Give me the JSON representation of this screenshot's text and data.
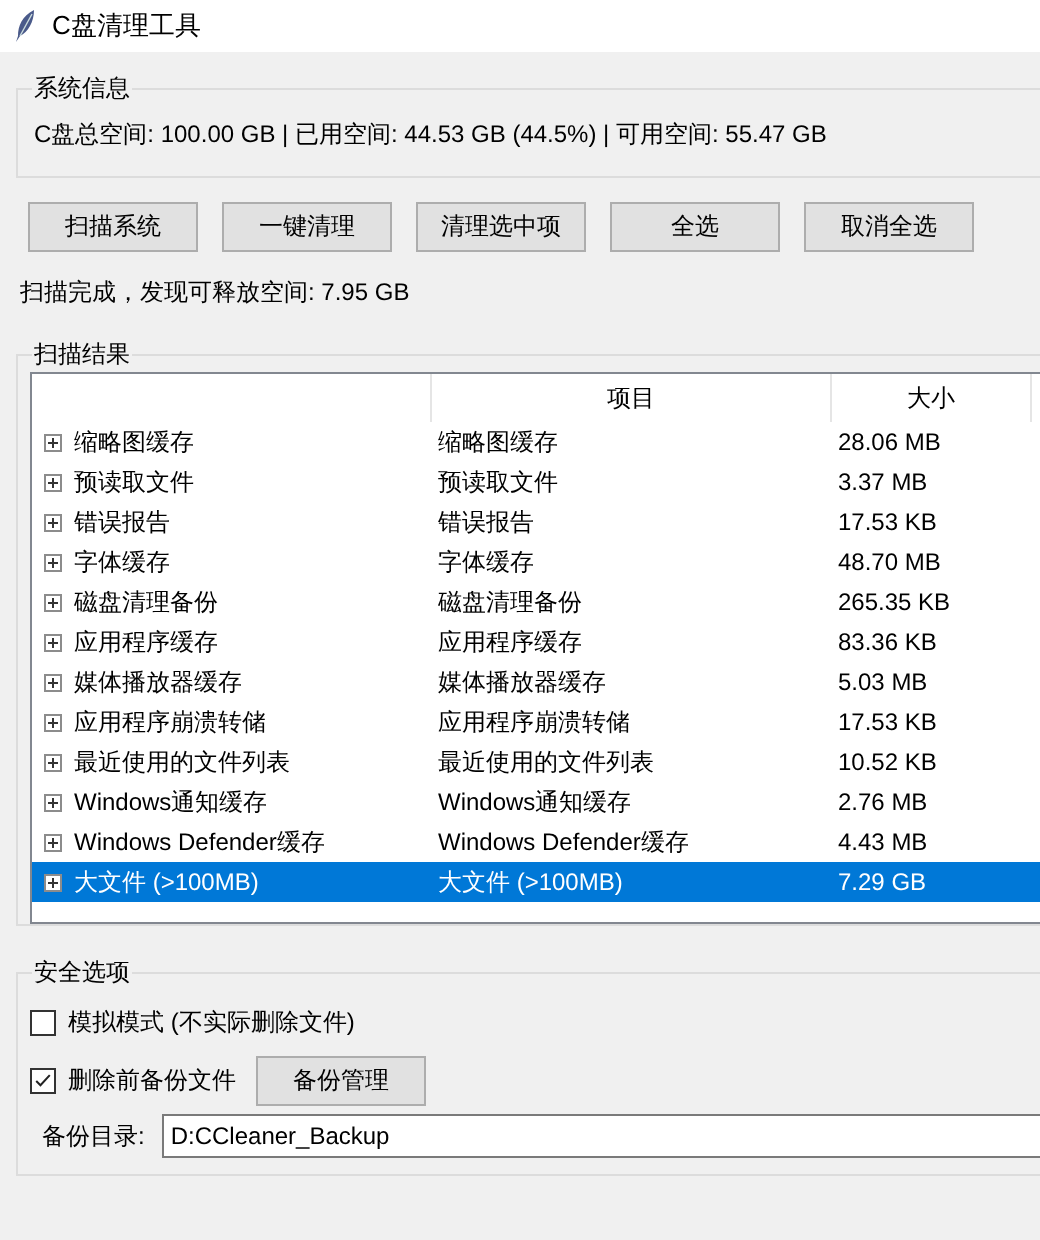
{
  "window": {
    "title": "C盘清理工具"
  },
  "system_info": {
    "title": "系统信息",
    "text": "C盘总空间: 100.00 GB | 已用空间: 44.53 GB (44.5%) | 可用空间: 55.47 GB"
  },
  "buttons": [
    "扫描系统",
    "一键清理",
    "清理选中项",
    "全选",
    "取消全选"
  ],
  "status": "扫描完成，发现可释放空间: 7.95 GB",
  "results": {
    "title": "扫描结果",
    "columns": [
      "项目",
      "大小"
    ],
    "rows": [
      {
        "name": "缩略图缓存",
        "item": "缩略图缓存",
        "size": "28.06 MB",
        "expanded": false,
        "selected": false
      },
      {
        "name": "预读取文件",
        "item": "预读取文件",
        "size": "3.37 MB",
        "expanded": false,
        "selected": false
      },
      {
        "name": "错误报告",
        "item": "错误报告",
        "size": "17.53 KB",
        "expanded": false,
        "selected": false
      },
      {
        "name": "字体缓存",
        "item": "字体缓存",
        "size": "48.70 MB",
        "expanded": false,
        "selected": false
      },
      {
        "name": "磁盘清理备份",
        "item": "磁盘清理备份",
        "size": "265.35 KB",
        "expanded": false,
        "selected": false
      },
      {
        "name": "应用程序缓存",
        "item": "应用程序缓存",
        "size": "83.36 KB",
        "expanded": false,
        "selected": false
      },
      {
        "name": "媒体播放器缓存",
        "item": "媒体播放器缓存",
        "size": "5.03 MB",
        "expanded": false,
        "selected": false
      },
      {
        "name": "应用程序崩溃转储",
        "item": "应用程序崩溃转储",
        "size": "17.53 KB",
        "expanded": false,
        "selected": false
      },
      {
        "name": "最近使用的文件列表",
        "item": "最近使用的文件列表",
        "size": "10.52 KB",
        "expanded": false,
        "selected": false
      },
      {
        "name": "Windows通知缓存",
        "item": "Windows通知缓存",
        "size": "2.76 MB",
        "expanded": false,
        "selected": false
      },
      {
        "name": "Windows Defender缓存",
        "item": "Windows Defender缓存",
        "size": "4.43 MB",
        "expanded": false,
        "selected": false
      },
      {
        "name": "大文件 (>100MB)",
        "item": "大文件 (>100MB)",
        "size": "7.29 GB",
        "expanded": false,
        "selected": true
      }
    ]
  },
  "safety": {
    "title": "安全选项",
    "options": [
      {
        "label": "模拟模式 (不实际删除文件)",
        "checked": false
      },
      {
        "label": "删除前备份文件",
        "checked": true
      }
    ],
    "backup_button": "备份管理",
    "dir_label": "备份目录:",
    "dir_value": "D:CCleaner_Backup"
  }
}
